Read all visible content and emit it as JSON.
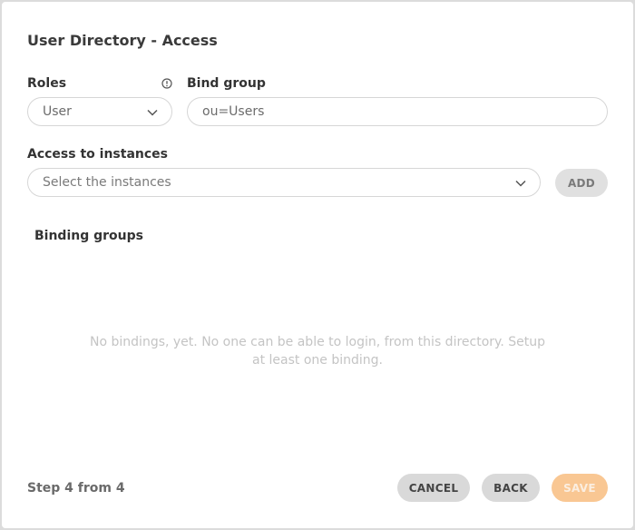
{
  "dialog": {
    "title": "User Directory - Access"
  },
  "roles": {
    "label": "Roles",
    "value": "User",
    "info_icon": "info-icon",
    "dropdown_icon": "chevron-down-icon"
  },
  "bind_group": {
    "label": "Bind group",
    "value": "ou=Users"
  },
  "instances": {
    "label": "Access to instances",
    "placeholder": "Select the instances",
    "dropdown_icon": "chevron-down-icon",
    "add_label": "ADD"
  },
  "binding_groups": {
    "label": "Binding groups",
    "empty_message": "No bindings, yet. No one can be able to login, from this directory. Setup at least one binding."
  },
  "footer": {
    "step": "Step 4 from 4",
    "cancel_label": "CANCEL",
    "back_label": "BACK",
    "save_label": "SAVE"
  },
  "colors": {
    "save_button": "#f9c793",
    "secondary_button": "#d9d9d9",
    "empty_text": "#c4c4c4"
  }
}
